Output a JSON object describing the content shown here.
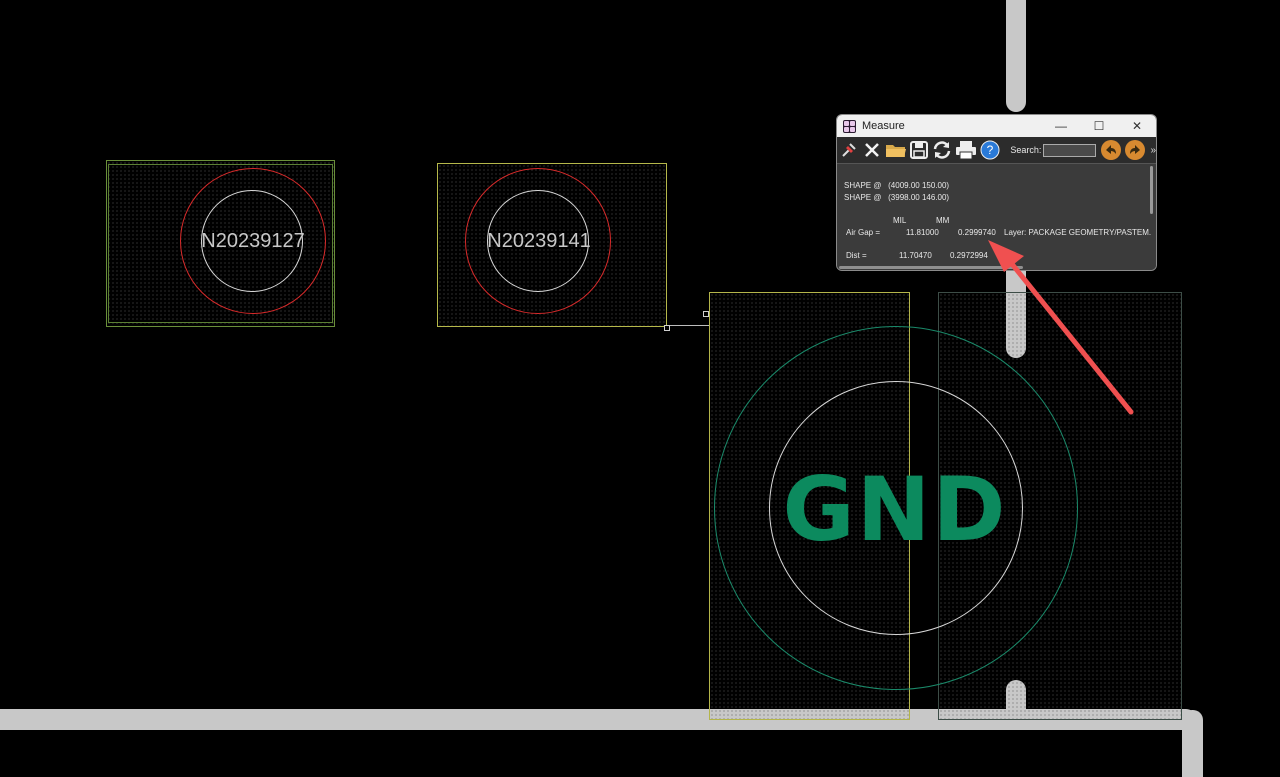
{
  "canvas": {
    "pads": [
      {
        "label": "N20239127"
      },
      {
        "label": "N20239141"
      },
      {
        "label": "GND"
      }
    ]
  },
  "measure": {
    "title": "Measure",
    "window_controls": {
      "minimize": "—",
      "maximize": "☐",
      "close": "✕"
    },
    "toolbar": {
      "search_label": "Search:",
      "search_value": "",
      "more": "»",
      "icons": [
        "pin-icon",
        "close-x-icon",
        "folder-icon",
        "save-icon",
        "refresh-icon",
        "print-icon",
        "help-icon",
        "undo-icon",
        "redo-icon"
      ]
    },
    "lines": {
      "shape1": "SHAPE @   (4009.00 150.00)",
      "shape2": "SHAPE @   (3998.00 146.00)",
      "col_mil": "MIL",
      "col_mm": "MM",
      "airgap_label": "Air Gap =",
      "airgap_mil": "11.81000",
      "airgap_mm": "0.2999740",
      "airgap_layer": "Layer: PACKAGE GEOMETRY/PASTEM.",
      "dist_label": "Dist =",
      "dist_mil": "11.70470",
      "dist_mm": "0.2972994"
    }
  },
  "colors": {
    "trace": "#c8c8c8",
    "red_ring": "#d82a2a",
    "gnd_text": "#0c8a5e",
    "annotation_arrow": "#f05050"
  }
}
